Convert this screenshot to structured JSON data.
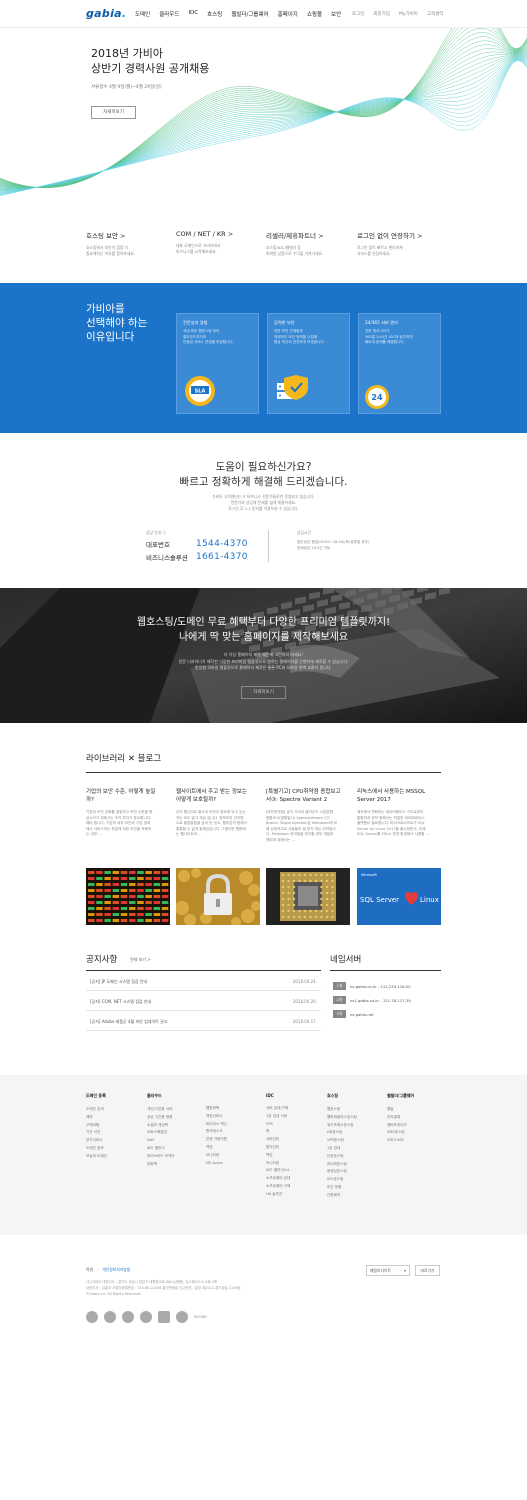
{
  "header": {
    "logo": "gabia",
    "nav": [
      "도메인",
      "클라우드",
      "IDC",
      "호스팅",
      "웹빌더/그룹웨어",
      "홈페이지",
      "쇼핑몰",
      "보안"
    ],
    "util": [
      "로그인",
      "회원가입",
      "My가비아",
      "고객센터"
    ]
  },
  "hero": {
    "title_line1": "2018년 가비아",
    "title_line2": "상반기 경력사원 공개채용",
    "period": "서류접수 4월 9일(월)~4월 29일(일)",
    "button": "자세히보기"
  },
  "features": [
    {
      "title": "호스팅 보안",
      "desc": [
        "호스팅에서 보안이 점점 더",
        "중요해지는 이유를 알아보세요."
      ]
    },
    {
      "title": "COM / NET / KR",
      "desc": [
        "대표 도메인으로 가비아에서",
        "비즈니스를 시작해보세요."
      ]
    },
    {
      "title": "리셀러/제휴파트너",
      "desc": [
        "호스팅/IDC/웹빌더 등",
        "특화된 상품으로 수익을 가져가세요."
      ]
    },
    {
      "title": "로그인 없이 연장하기",
      "desc": [
        "로그인 없이 빠르고 편리하게",
        "서비스를 연장하세요."
      ]
    }
  ],
  "why": {
    "title": [
      "가비아를",
      "선택해야 하는",
      "이유입니다"
    ],
    "cards": [
      {
        "title": "전문성과 경험",
        "desc": [
          "국내 최초 웹호스팅 부터",
          "클라우드까지의",
          "안정된 서비스 운영을 보장합니다."
        ],
        "icon": "sla-badge-icon",
        "icon_text": "SLA"
      },
      {
        "title": "강력한 보안",
        "desc": [
          "전문 보안 관제팀과",
          "체계적인 보안 정책을 수립해",
          "항상 최신의 안전하게 보호합니다."
        ],
        "icon": "shield-server-icon"
      },
      {
        "title": "24/365 서비 관리",
        "desc": [
          "전문 엔지니어가",
          "365일 24시간 IDC에 상주하여",
          "빠르게 문제를 해결합니다."
        ],
        "icon": "24-hours-icon",
        "icon_text": "24"
      }
    ]
  },
  "help": {
    "title_line1": "도움이 필요하신가요?",
    "title_line2": "빠르고 정확하게 해결해 드리겠습니다.",
    "desc": [
      "가비아 고객센터는 IT 비즈니스 전문가들로만 운영되고 있습니다.",
      "전문가와 상담해 문제를 쉽게 해결하세요.",
      "로그인 후 1:1 문의를 이용하실 수 있습니다."
    ],
    "contact_label": "상담 안내",
    "rows": [
      {
        "name": "대표번호",
        "phone": "1544-4370"
      },
      {
        "name": "비즈니스솔루션",
        "phone": "1661-4370"
      }
    ],
    "hours_label": "상담시간",
    "hours": [
      "일반상담 평일(09:00~18:00)/토(공휴일 휴무)",
      "장애상담 24시간 가능"
    ]
  },
  "banner": {
    "title_line1": "웹호스팅/도메인 무료 혜택부터 다양한 프리미엄 템플릿까지!",
    "title_line2": "나에게 딱 맞는 홈페이지를 제작해보세요",
    "desc": [
      "더 이상 홈페이지 제작 때문에 고민하지 마세요!",
      "전문 디자이너가 제작한 다양한 프리미엄 템플릿으로 원하는 홈페이지를 간편하게 제작할 수 있습니다.",
      "반응형 모바일 템플릿으로 홈페이지 제작은 물론 PC와 모바일 완벽 호환이 됩니다."
    ],
    "button": "자세히보기"
  },
  "library": {
    "title_a": "라이브러리",
    "title_x": "✕",
    "title_b": "블로그",
    "posts": [
      {
        "title": [
          "기업의 보안 수준, 어떻게 높일",
          "까?"
        ],
        "desc": [
          "기업의 보안 강화를 결정하고 보안 수준을 향",
          "상시키기 위해서는 조직 투자가 중요합니다.",
          "해야 합니다. 기업의 내부 보안과 기업 경계",
          "에서 서비스하는 부분에 대한 보안을 적용하",
          "는 내부 …"
        ]
      },
      {
        "title": [
          "웹사이트에서 주고 받는 정보는",
          "어떻게 보호될까?"
        ],
        "desc": [
          "우리 웹사이트 회사의 보안이 중요해 되고 있는",
          "지는 모두 알고 계실 겁니다. 정보보호 관리법",
          "으로 통합통합을 꿈이 듯 짓고, 웹부암의 합에서",
          "통합할 수 없게 통해있습니다. 그렇다면 웹환에",
          "는 웹사이트의 …"
        ]
      },
      {
        "title": [
          "[특별기고] CPU취약점 종합보고",
          "서③: Spectre Variant 2"
        ],
        "desc": [
          "[보안취약점] 공식 가비아 클라우드 시장분향",
          "종합조사(발행일시) SpectreVariant 2인",
          "Branch Target Injection은 Meltdown에 비",
          "해 상대적으로 사람들의 덜 받지 하는 취약점이",
          "다. Meltdown 취약점을 방지할 경우 개발한",
          "엔티에 대해서는 …"
        ]
      },
      {
        "title": [
          "리눅스에서 사용하는 MSSQL",
          "Server 2017"
        ],
        "desc": [
          "계속해서 변화하는 데이터베이스 구조로부터",
          "통합하게 양적 위해서는 적절한 데이터베이스",
          "플랫폼이 필요합니다. 마이크로소프트가 SQL",
          "Server on Linux 2017을 출시하면서, 이제",
          "SQL Server를 리눅스 운영 환경에서 사용할 …"
        ]
      }
    ],
    "thumb4_brand": "Microsoft",
    "thumb4_left": "SQL Server",
    "thumb4_right": "Linux"
  },
  "notice": {
    "title": "공지사항",
    "more": "전체 보기",
    "items": [
      {
        "title": "[공지] JP 도메인 시스템 점검 안내",
        "date": "2018.04.24."
      },
      {
        "title": "[공지] COM, NET 시스템 점검 안내",
        "date": "2018.04.20."
      },
      {
        "title": "[공지] Adobe 제품군 4월 보안 업데이트 권고",
        "date": "2018.04.17."
      }
    ]
  },
  "nameserver": {
    "title": "네임서버",
    "items": [
      {
        "badge": "1차",
        "value": "ns.gabia.co.kr - 211.234.118.50"
      },
      {
        "badge": "2차",
        "value": "ns1.gabia.co.kr - 121.78.117.39"
      },
      {
        "badge": "3차",
        "value": "ns.gabia.net"
      }
    ]
  },
  "footer": {
    "cols": [
      {
        "title": "도메인 등록",
        "items": [
          "도메인 검색",
          "예약",
          "구매대행",
          "기관 이전",
          "부가서비스",
          "도메인 정보",
          "모실의 도메인"
        ]
      },
      {
        "title": "클라우드",
        "items": [
          "개인/기업용 서버",
          "공공 기관용 명용",
          "소설보 게임팩",
          "모토스퀘일업",
          "NAS",
          "로드 밸런서",
          "하이브리드 커넥터",
          "방화벽"
        ]
      },
      {
        "title": "",
        "items": [
          "웹방화벽",
          "백업서비스",
          "바이러스 백신",
          "원격데스크",
          "콘텐 가용지원",
          "백업",
          "모니터링",
          "MS Azure"
        ]
      },
      {
        "title": "IDC",
        "items": [
          "서버 임대/구매",
          "1분 임대 서버",
          "VPS",
          "랙",
          "서버관리",
          "원지관리",
          "백업",
          "모니터링",
          "로드 밸런서/L4",
          "소프트웨어 임대",
          "소프트웨어 구매",
          "HA 솔루션"
        ]
      },
      {
        "title": "호스팅",
        "items": [
          "웹호스팅",
          "웹파워클릭스호스팅",
          "워드프레스호스팅",
          "DB호스팅",
          "VPS호스팅",
          "1분 임대",
          "단위호스팅",
          "하이퍼호스팅",
          "동영상호스팅",
          "SSL호스팅",
          "미인 대행",
          "간편제작"
        ]
      },
      {
        "title": "웹빌더/그룹웨어",
        "items": [
          "웹빌",
          "전자결제",
          "엔버프러이즈",
          "SMS호스팅",
          "오피스365"
        ]
      }
    ],
    "link1": "약관",
    "link2": "개인정보처리방침",
    "addr": [
      "(주)가비아 대표이사 : 경기도 성남시 분당구 대왕판교로 660(삼평동, 유스페이스1) A동 4층",
      "대표이사 : 김홍국 사업자등록번호 : 114-86-22358 통신판매업 신고번호 : 분당 제2012-경기성남-1106호",
      "©Gabia Inc. All Rights Reserved."
    ],
    "family_site": "패밀리사이트",
    "go": "바로가기",
    "cert_text": "KOCSRC"
  }
}
